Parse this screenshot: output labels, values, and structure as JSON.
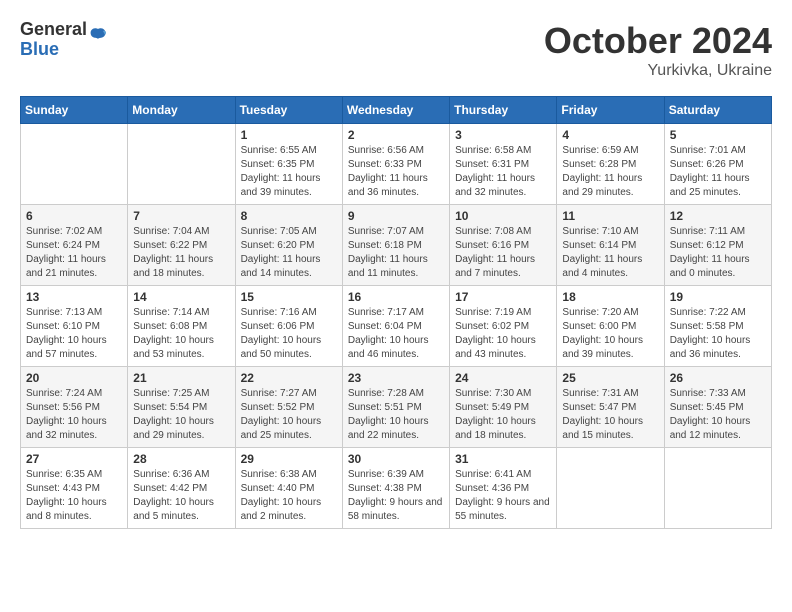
{
  "header": {
    "logo_general": "General",
    "logo_blue": "Blue",
    "month": "October 2024",
    "location": "Yurkivka, Ukraine"
  },
  "days_of_week": [
    "Sunday",
    "Monday",
    "Tuesday",
    "Wednesday",
    "Thursday",
    "Friday",
    "Saturday"
  ],
  "weeks": [
    [
      {
        "day": "",
        "info": ""
      },
      {
        "day": "",
        "info": ""
      },
      {
        "day": "1",
        "info": "Sunrise: 6:55 AM\nSunset: 6:35 PM\nDaylight: 11 hours and 39 minutes."
      },
      {
        "day": "2",
        "info": "Sunrise: 6:56 AM\nSunset: 6:33 PM\nDaylight: 11 hours and 36 minutes."
      },
      {
        "day": "3",
        "info": "Sunrise: 6:58 AM\nSunset: 6:31 PM\nDaylight: 11 hours and 32 minutes."
      },
      {
        "day": "4",
        "info": "Sunrise: 6:59 AM\nSunset: 6:28 PM\nDaylight: 11 hours and 29 minutes."
      },
      {
        "day": "5",
        "info": "Sunrise: 7:01 AM\nSunset: 6:26 PM\nDaylight: 11 hours and 25 minutes."
      }
    ],
    [
      {
        "day": "6",
        "info": "Sunrise: 7:02 AM\nSunset: 6:24 PM\nDaylight: 11 hours and 21 minutes."
      },
      {
        "day": "7",
        "info": "Sunrise: 7:04 AM\nSunset: 6:22 PM\nDaylight: 11 hours and 18 minutes."
      },
      {
        "day": "8",
        "info": "Sunrise: 7:05 AM\nSunset: 6:20 PM\nDaylight: 11 hours and 14 minutes."
      },
      {
        "day": "9",
        "info": "Sunrise: 7:07 AM\nSunset: 6:18 PM\nDaylight: 11 hours and 11 minutes."
      },
      {
        "day": "10",
        "info": "Sunrise: 7:08 AM\nSunset: 6:16 PM\nDaylight: 11 hours and 7 minutes."
      },
      {
        "day": "11",
        "info": "Sunrise: 7:10 AM\nSunset: 6:14 PM\nDaylight: 11 hours and 4 minutes."
      },
      {
        "day": "12",
        "info": "Sunrise: 7:11 AM\nSunset: 6:12 PM\nDaylight: 11 hours and 0 minutes."
      }
    ],
    [
      {
        "day": "13",
        "info": "Sunrise: 7:13 AM\nSunset: 6:10 PM\nDaylight: 10 hours and 57 minutes."
      },
      {
        "day": "14",
        "info": "Sunrise: 7:14 AM\nSunset: 6:08 PM\nDaylight: 10 hours and 53 minutes."
      },
      {
        "day": "15",
        "info": "Sunrise: 7:16 AM\nSunset: 6:06 PM\nDaylight: 10 hours and 50 minutes."
      },
      {
        "day": "16",
        "info": "Sunrise: 7:17 AM\nSunset: 6:04 PM\nDaylight: 10 hours and 46 minutes."
      },
      {
        "day": "17",
        "info": "Sunrise: 7:19 AM\nSunset: 6:02 PM\nDaylight: 10 hours and 43 minutes."
      },
      {
        "day": "18",
        "info": "Sunrise: 7:20 AM\nSunset: 6:00 PM\nDaylight: 10 hours and 39 minutes."
      },
      {
        "day": "19",
        "info": "Sunrise: 7:22 AM\nSunset: 5:58 PM\nDaylight: 10 hours and 36 minutes."
      }
    ],
    [
      {
        "day": "20",
        "info": "Sunrise: 7:24 AM\nSunset: 5:56 PM\nDaylight: 10 hours and 32 minutes."
      },
      {
        "day": "21",
        "info": "Sunrise: 7:25 AM\nSunset: 5:54 PM\nDaylight: 10 hours and 29 minutes."
      },
      {
        "day": "22",
        "info": "Sunrise: 7:27 AM\nSunset: 5:52 PM\nDaylight: 10 hours and 25 minutes."
      },
      {
        "day": "23",
        "info": "Sunrise: 7:28 AM\nSunset: 5:51 PM\nDaylight: 10 hours and 22 minutes."
      },
      {
        "day": "24",
        "info": "Sunrise: 7:30 AM\nSunset: 5:49 PM\nDaylight: 10 hours and 18 minutes."
      },
      {
        "day": "25",
        "info": "Sunrise: 7:31 AM\nSunset: 5:47 PM\nDaylight: 10 hours and 15 minutes."
      },
      {
        "day": "26",
        "info": "Sunrise: 7:33 AM\nSunset: 5:45 PM\nDaylight: 10 hours and 12 minutes."
      }
    ],
    [
      {
        "day": "27",
        "info": "Sunrise: 6:35 AM\nSunset: 4:43 PM\nDaylight: 10 hours and 8 minutes."
      },
      {
        "day": "28",
        "info": "Sunrise: 6:36 AM\nSunset: 4:42 PM\nDaylight: 10 hours and 5 minutes."
      },
      {
        "day": "29",
        "info": "Sunrise: 6:38 AM\nSunset: 4:40 PM\nDaylight: 10 hours and 2 minutes."
      },
      {
        "day": "30",
        "info": "Sunrise: 6:39 AM\nSunset: 4:38 PM\nDaylight: 9 hours and 58 minutes."
      },
      {
        "day": "31",
        "info": "Sunrise: 6:41 AM\nSunset: 4:36 PM\nDaylight: 9 hours and 55 minutes."
      },
      {
        "day": "",
        "info": ""
      },
      {
        "day": "",
        "info": ""
      }
    ]
  ]
}
